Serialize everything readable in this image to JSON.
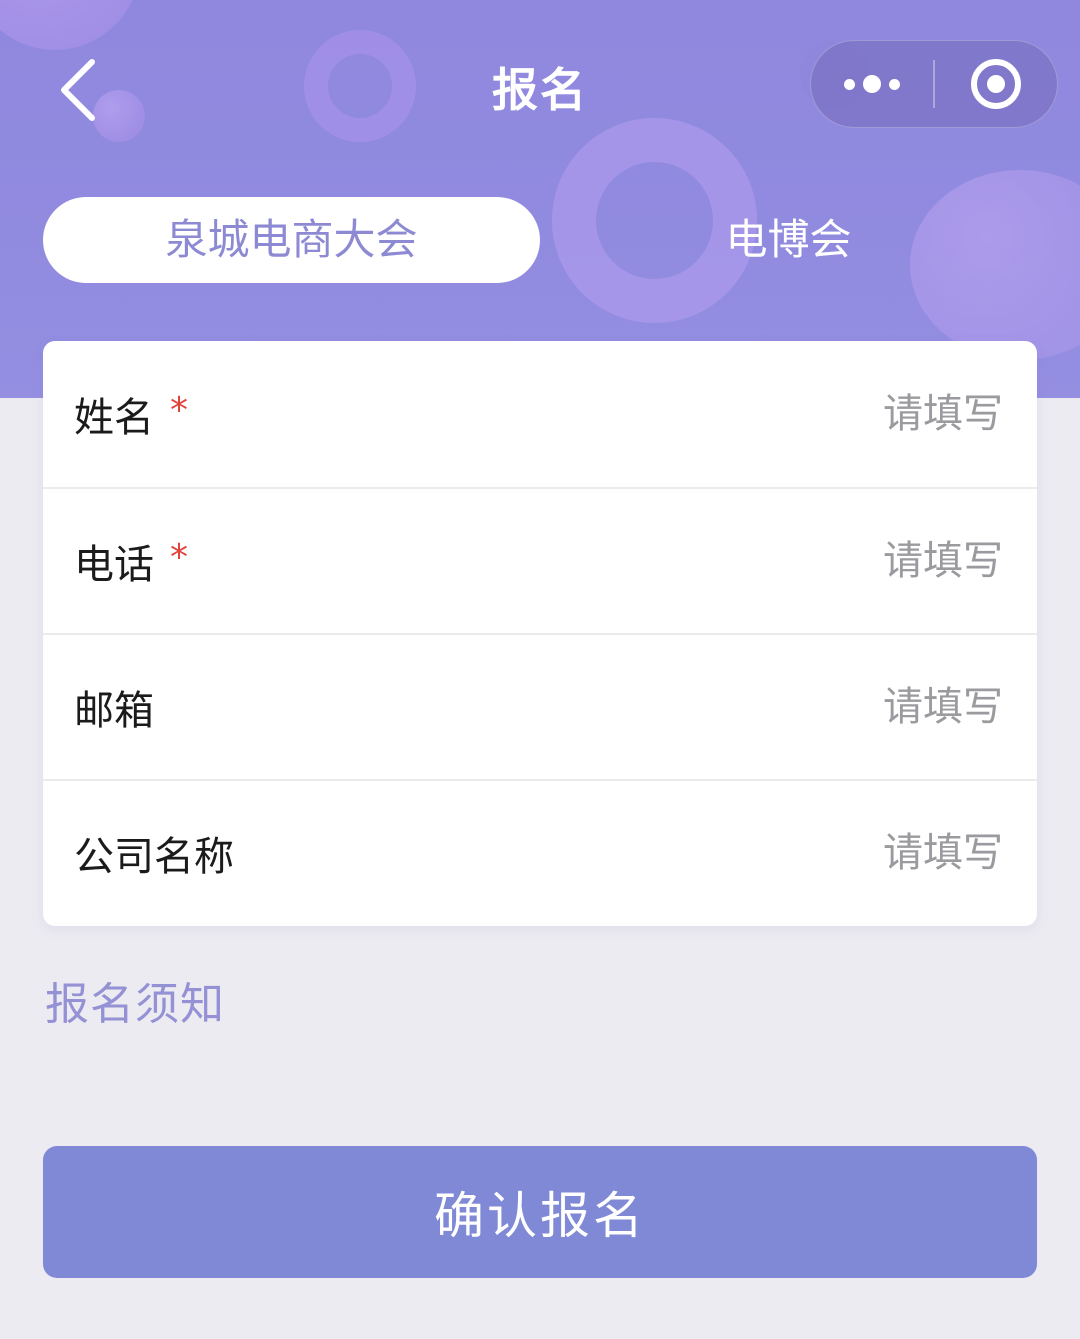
{
  "nav": {
    "title": "报名",
    "back_icon": "chevron-left-icon",
    "more_icon": "more-dots-icon",
    "close_icon": "target-circle-icon"
  },
  "tabs": [
    {
      "label": "泉城电商大会",
      "active": true
    },
    {
      "label": "电博会",
      "active": false
    }
  ],
  "form": {
    "fields": [
      {
        "label": "姓名",
        "required": true,
        "required_mark": "*",
        "placeholder": "请填写",
        "value": ""
      },
      {
        "label": "电话",
        "required": true,
        "required_mark": "*",
        "placeholder": "请填写",
        "value": ""
      },
      {
        "label": "邮箱",
        "required": false,
        "placeholder": "请填写",
        "value": ""
      },
      {
        "label": "公司名称",
        "required": false,
        "placeholder": "请填写",
        "value": ""
      }
    ]
  },
  "notice": {
    "label": "报名须知"
  },
  "submit": {
    "label": "确认报名"
  },
  "colors": {
    "header_bg": "#918be0",
    "accent": "#7f89d6",
    "tab_active_text": "#8d8ad3",
    "notice_text": "#9491d4",
    "required": "#e0443a"
  }
}
